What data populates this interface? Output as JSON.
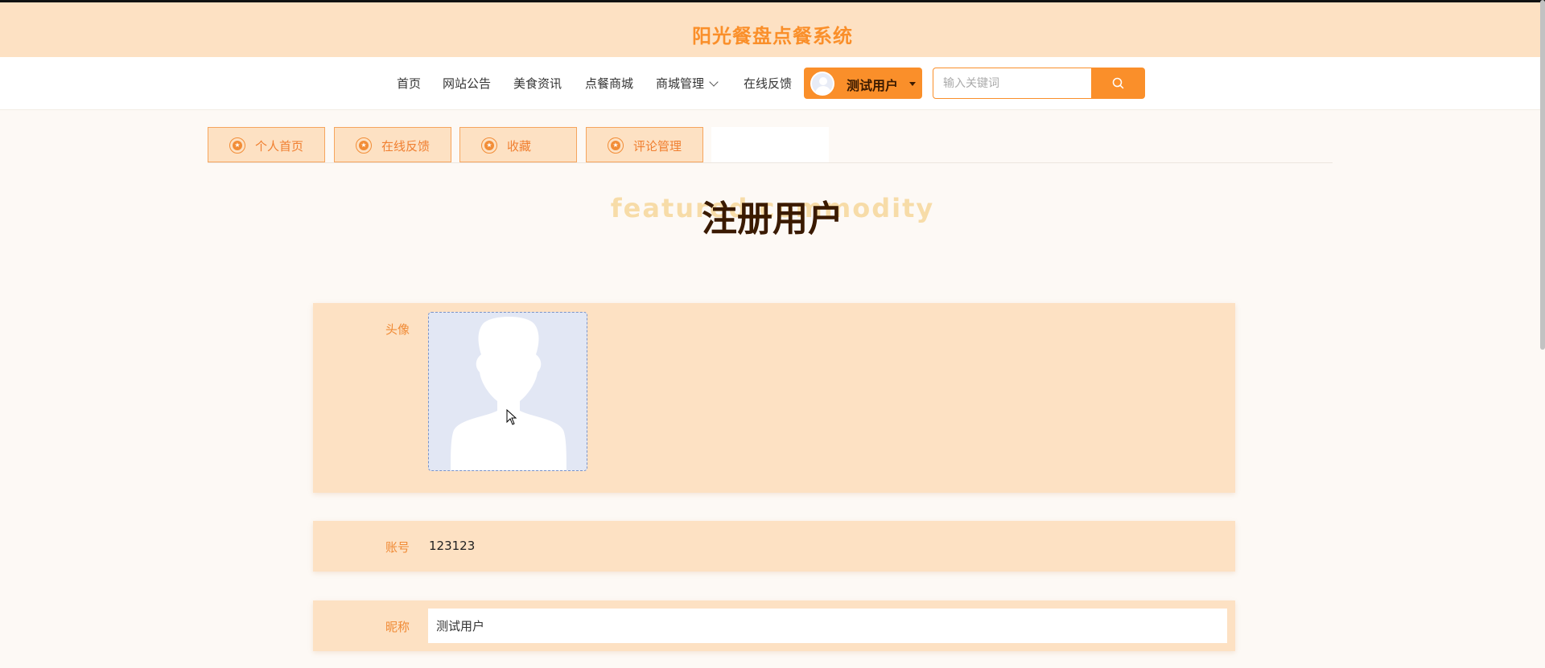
{
  "header": {
    "title": "阳光餐盘点餐系统"
  },
  "nav": {
    "items": [
      {
        "label": "首页"
      },
      {
        "label": "网站公告"
      },
      {
        "label": "美食资讯"
      },
      {
        "label": "点餐商城"
      },
      {
        "label": "商城管理"
      },
      {
        "label": "在线反馈"
      }
    ],
    "user": {
      "name": "测试用户"
    },
    "search": {
      "placeholder": "输入关键词",
      "value": ""
    }
  },
  "tabs": [
    {
      "label": "个人首页"
    },
    {
      "label": "在线反馈"
    },
    {
      "label": "收藏"
    },
    {
      "label": "评论管理"
    }
  ],
  "section": {
    "title": "注册用户",
    "background_text": "featured commodity"
  },
  "form": {
    "avatar": {
      "label": "头像",
      "icon": "default-avatar-icon"
    },
    "account": {
      "label": "账号",
      "value": "123123"
    },
    "nickname": {
      "label": "昵称",
      "value": "测试用户"
    }
  },
  "colors": {
    "accent": "#fa8f2a",
    "header_bg": "#fde1c3",
    "title_dark": "#3a1a00",
    "label": "#f08a35"
  }
}
